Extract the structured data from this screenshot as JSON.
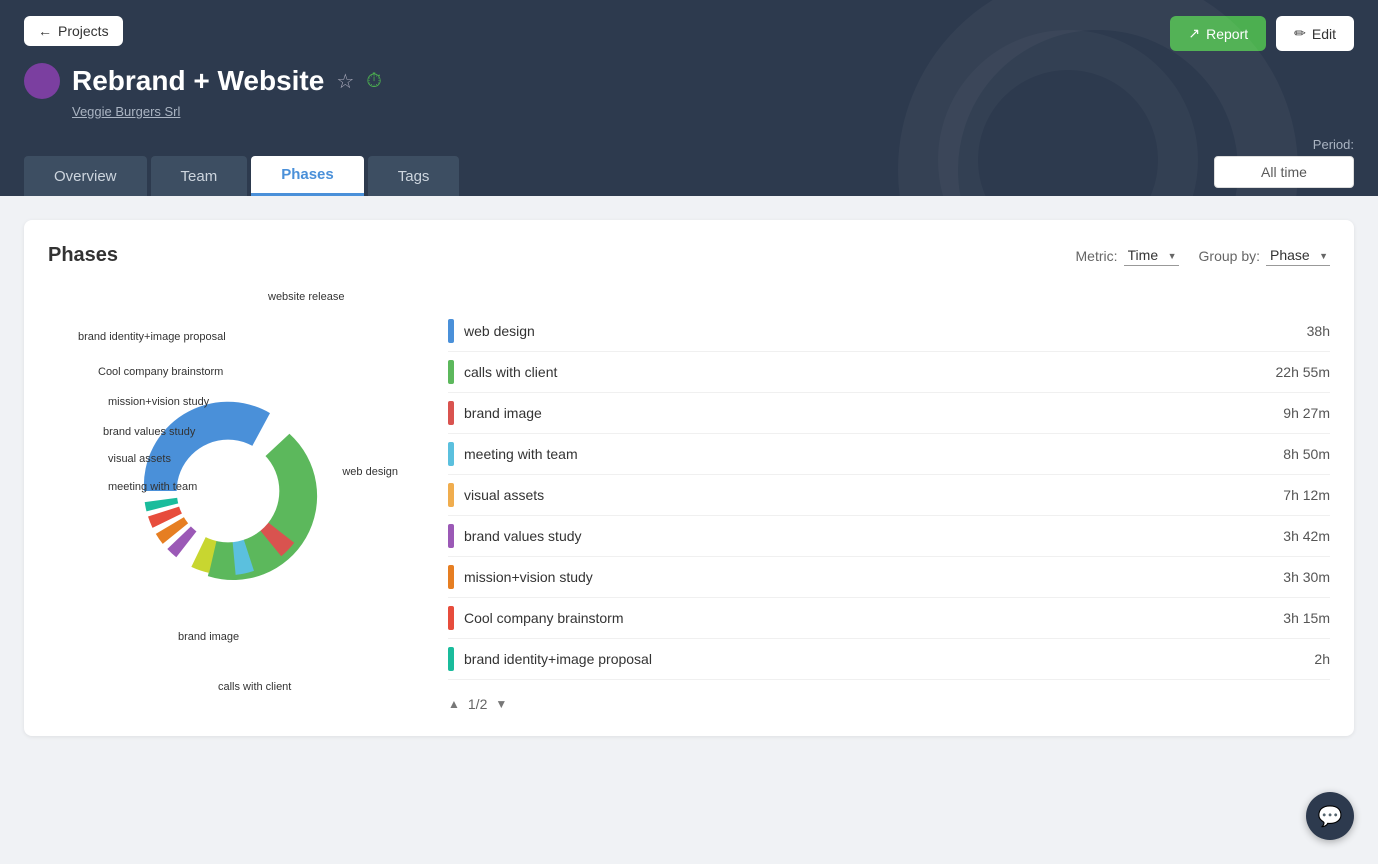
{
  "header": {
    "projects_label": "Projects",
    "project_title": "Rebrand + Website",
    "company_name": "Veggie Burgers Srl",
    "report_label": "Report",
    "edit_label": "Edit",
    "period_label": "Period:",
    "period_value": "All time"
  },
  "tabs": [
    {
      "id": "overview",
      "label": "Overview",
      "active": false
    },
    {
      "id": "team",
      "label": "Team",
      "active": false
    },
    {
      "id": "phases",
      "label": "Phases",
      "active": true
    },
    {
      "id": "tags",
      "label": "Tags",
      "active": false
    }
  ],
  "phases_card": {
    "title": "Phases",
    "metric_label": "Metric:",
    "metric_value": "Time",
    "group_by_label": "Group by:",
    "group_by_value": "Phase"
  },
  "chart_data": [
    {
      "name": "web design",
      "value": "38h",
      "color": "#4a90d9",
      "percent": 38
    },
    {
      "name": "calls with client",
      "value": "22h 55m",
      "color": "#5cb85c",
      "percent": 22.5
    },
    {
      "name": "brand image",
      "value": "9h 27m",
      "color": "#d9534f",
      "percent": 9.5
    },
    {
      "name": "meeting with team",
      "value": "8h 50m",
      "color": "#5bc0de",
      "percent": 8.5
    },
    {
      "name": "visual assets",
      "value": "7h 12m",
      "color": "#f0ad4e",
      "percent": 7
    },
    {
      "name": "brand values study",
      "value": "3h 42m",
      "color": "#9b59b6",
      "percent": 3.7
    },
    {
      "name": "mission+vision study",
      "value": "3h 30m",
      "color": "#e67e22",
      "percent": 3.5
    },
    {
      "name": "Cool company brainstorm",
      "value": "3h 15m",
      "color": "#e74c3c",
      "percent": 3.2
    },
    {
      "name": "brand identity+image proposal",
      "value": "2h",
      "color": "#1abc9c",
      "percent": 2
    }
  ],
  "pagination": {
    "current": "1",
    "total": "2"
  },
  "chat_icon": "💬"
}
